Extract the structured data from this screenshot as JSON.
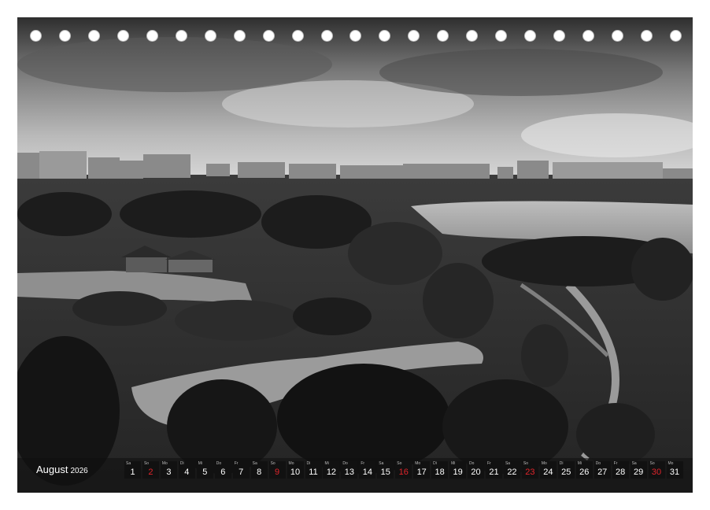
{
  "calendar": {
    "month": "August",
    "year": "2026",
    "days": [
      {
        "wd": "Sa",
        "num": "1",
        "weekend": false
      },
      {
        "wd": "So",
        "num": "2",
        "weekend": true
      },
      {
        "wd": "Mo",
        "num": "3",
        "weekend": false
      },
      {
        "wd": "Di",
        "num": "4",
        "weekend": false
      },
      {
        "wd": "Mi",
        "num": "5",
        "weekend": false
      },
      {
        "wd": "Do",
        "num": "6",
        "weekend": false
      },
      {
        "wd": "Fr",
        "num": "7",
        "weekend": false
      },
      {
        "wd": "Sa",
        "num": "8",
        "weekend": false
      },
      {
        "wd": "So",
        "num": "9",
        "weekend": true
      },
      {
        "wd": "Mo",
        "num": "10",
        "weekend": false
      },
      {
        "wd": "Di",
        "num": "11",
        "weekend": false
      },
      {
        "wd": "Mi",
        "num": "12",
        "weekend": false
      },
      {
        "wd": "Do",
        "num": "13",
        "weekend": false
      },
      {
        "wd": "Fr",
        "num": "14",
        "weekend": false
      },
      {
        "wd": "Sa",
        "num": "15",
        "weekend": false
      },
      {
        "wd": "So",
        "num": "16",
        "weekend": true
      },
      {
        "wd": "Mo",
        "num": "17",
        "weekend": false
      },
      {
        "wd": "Di",
        "num": "18",
        "weekend": false
      },
      {
        "wd": "Mi",
        "num": "19",
        "weekend": false
      },
      {
        "wd": "Do",
        "num": "20",
        "weekend": false
      },
      {
        "wd": "Fr",
        "num": "21",
        "weekend": false
      },
      {
        "wd": "Sa",
        "num": "22",
        "weekend": false
      },
      {
        "wd": "So",
        "num": "23",
        "weekend": true
      },
      {
        "wd": "Mo",
        "num": "24",
        "weekend": false
      },
      {
        "wd": "Di",
        "num": "25",
        "weekend": false
      },
      {
        "wd": "Mi",
        "num": "26",
        "weekend": false
      },
      {
        "wd": "Do",
        "num": "27",
        "weekend": false
      },
      {
        "wd": "Fr",
        "num": "28",
        "weekend": false
      },
      {
        "wd": "Sa",
        "num": "29",
        "weekend": false
      },
      {
        "wd": "So",
        "num": "30",
        "weekend": true
      },
      {
        "wd": "Mo",
        "num": "31",
        "weekend": false
      }
    ]
  },
  "colors": {
    "weekend": "#e0242b",
    "day_cell": "#111111",
    "text": "#ffffff"
  }
}
